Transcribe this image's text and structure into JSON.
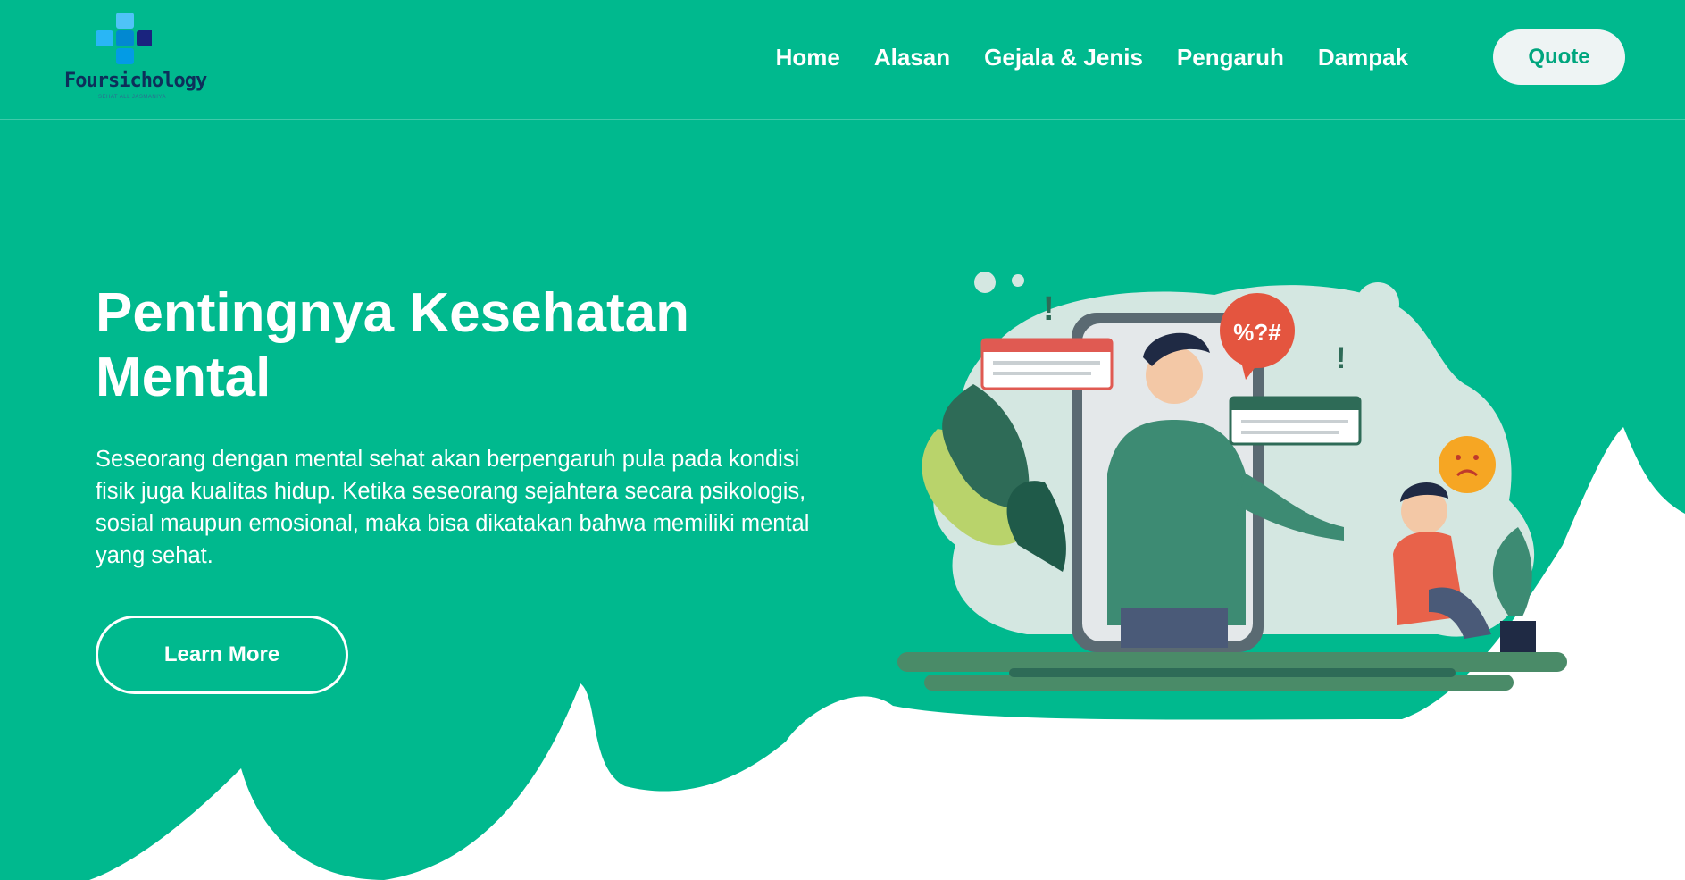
{
  "colors": {
    "brand": "#00b98e",
    "white": "#ffffff",
    "quote_bg": "#eef4f4",
    "logo_dark": "#0d2f5a"
  },
  "brand": {
    "name": "Foursichology",
    "tagline": "SEHAT ALL JASMANIYA",
    "icon": "medical-cross-logo"
  },
  "nav": {
    "items": [
      "Home",
      "Alasan",
      "Gejala & Jenis",
      "Pengaruh",
      "Dampak"
    ],
    "cta": "Quote"
  },
  "hero": {
    "title": "Pentingnya Kesehatan Mental",
    "text": "Seseorang dengan mental sehat akan berpengaruh pula pada kondisi fisik juga kualitas hidup. Ketika seseorang sejahtera secara psikologis, sosial maupun emosional, maka bisa dikatakan bahwa memiliki mental yang sehat.",
    "button": "Learn More"
  },
  "illustration": {
    "speech_symbols": "%?#",
    "exclaim": "!",
    "icon": "mental-health-illustration"
  }
}
